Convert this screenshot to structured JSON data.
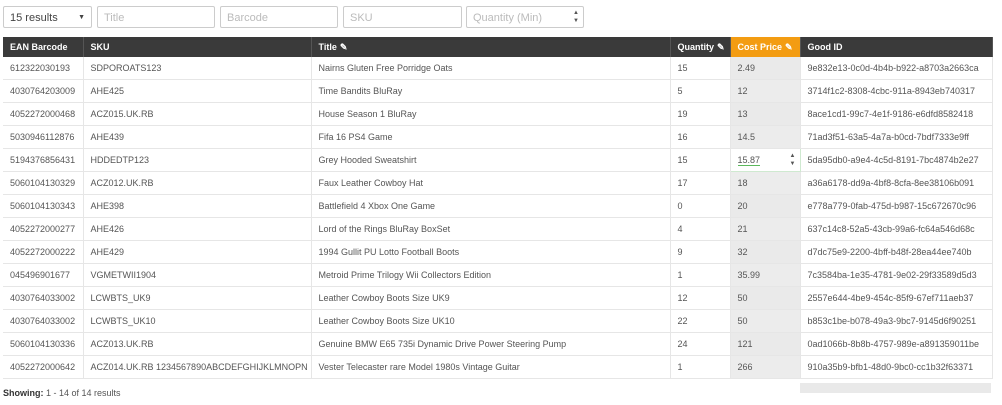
{
  "filters": {
    "results_select": "15 results",
    "title_placeholder": "Title",
    "barcode_placeholder": "Barcode",
    "sku_placeholder": "SKU",
    "quantity_placeholder": "Quantity (Min)"
  },
  "columns": {
    "ean": "EAN Barcode",
    "sku": "SKU",
    "title": "Title",
    "quantity": "Quantity",
    "cost": "Cost Price",
    "good_id": "Good ID"
  },
  "rows": [
    {
      "ean": "612322030193",
      "sku": "SDPOROATS123",
      "title": "Nairns Gluten Free Porridge Oats",
      "qty": "15",
      "cost": "2.49",
      "gid": "9e832e13-0c0d-4b4b-b922-a8703a2663ca"
    },
    {
      "ean": "4030764203009",
      "sku": "AHE425",
      "title": "Time Bandits BluRay",
      "qty": "5",
      "cost": "12",
      "gid": "3714f1c2-8308-4cbc-911a-8943eb740317"
    },
    {
      "ean": "4052272000468",
      "sku": "ACZ015.UK.RB",
      "title": "House Season 1 BluRay",
      "qty": "19",
      "cost": "13",
      "gid": "8ace1cd1-99c7-4e1f-9186-e6dfd8582418"
    },
    {
      "ean": "5030946112876",
      "sku": "AHE439",
      "title": "Fifa 16 PS4 Game",
      "qty": "16",
      "cost": "14.5",
      "gid": "71ad3f51-63a5-4a7a-b0cd-7bdf7333e9ff"
    },
    {
      "ean": "5194376856431",
      "sku": "HDDEDTP123",
      "title": "Grey Hooded Sweatshirt",
      "qty": "15",
      "cost": "15.87",
      "gid": "5da95db0-a9e4-4c5d-8191-7bc4874b2e27"
    },
    {
      "ean": "5060104130329",
      "sku": "ACZ012.UK.RB",
      "title": "Faux Leather Cowboy Hat",
      "qty": "17",
      "cost": "18",
      "gid": "a36a6178-dd9a-4bf8-8cfa-8ee38106b091"
    },
    {
      "ean": "5060104130343",
      "sku": "AHE398",
      "title": "Battlefield 4 Xbox One Game",
      "qty": "0",
      "cost": "20",
      "gid": "e778a779-0fab-475d-b987-15c672670c96"
    },
    {
      "ean": "4052272000277",
      "sku": "AHE426",
      "title": "Lord of the Rings BluRay BoxSet",
      "qty": "4",
      "cost": "21",
      "gid": "637c14c8-52a5-43cb-99a6-fc64a546d68c"
    },
    {
      "ean": "4052272000222",
      "sku": "AHE429",
      "title": "1994 Gullit PU Lotto Football Boots",
      "qty": "9",
      "cost": "32",
      "gid": "d7dc75e9-2200-4bff-b48f-28ea44ee740b"
    },
    {
      "ean": "045496901677",
      "sku": "VGMETWII1904",
      "title": "Metroid Prime Trilogy Wii Collectors Edition",
      "qty": "1",
      "cost": "35.99",
      "gid": "7c3584ba-1e35-4781-9e02-29f33589d5d3"
    },
    {
      "ean": "4030764033002",
      "sku": "LCWBTS_UK9",
      "title": "Leather Cowboy Boots Size UK9",
      "qty": "12",
      "cost": "50",
      "gid": "2557e644-4be9-454c-85f9-67ef711aeb37"
    },
    {
      "ean": "4030764033002",
      "sku": "LCWBTS_UK10",
      "title": "Leather Cowboy Boots Size UK10",
      "qty": "22",
      "cost": "50",
      "gid": "b853c1be-b078-49a3-9bc7-9145d6f90251"
    },
    {
      "ean": "5060104130336",
      "sku": "ACZ013.UK.RB",
      "title": "Genuine BMW E65 735i Dynamic Drive Power Steering Pump",
      "qty": "24",
      "cost": "121",
      "gid": "0ad1066b-8b8b-4757-989e-a891359011be"
    },
    {
      "ean": "4052272000642",
      "sku": "ACZ014.UK.RB 1234567890ABCDEFGHIJKLMNOPN",
      "title": "Vester Telecaster rare Model 1980s Vintage Guitar",
      "qty": "1",
      "cost": "266",
      "gid": "910a35b9-bfb1-48d0-9bc0-cc1b32f63371"
    }
  ],
  "footer": {
    "label": "Showing:",
    "text": "1 - 14 of 14 results"
  },
  "icons": [
    "pencil-icon",
    "caret-down-icon",
    "spinner-arrows-icon"
  ],
  "colors": {
    "header_bg": "#3a3a3a",
    "active_header": "#f39c12",
    "edit_border": "#5cb85c"
  }
}
